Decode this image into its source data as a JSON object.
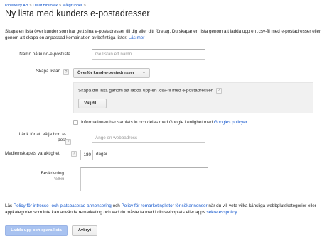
{
  "breadcrumb": {
    "items": [
      "Pineberry AB",
      "Delat bibliotek",
      "Målgrupper"
    ],
    "separator": ">"
  },
  "page": {
    "title": "Ny lista med kunders e-postadresser"
  },
  "intro": {
    "text": "Skapa en lista över kunder som har gett sina e-postadresser till dig eller ditt företag. Du skapar en lista genom att ladda upp en .csv-fil med e-postadresser eller genom att skapa en anpassad kombination av befintliga listor.",
    "link": "Läs mer"
  },
  "form": {
    "name": {
      "label": "Namn på kund-e-postlista",
      "placeholder": "Ge listan ett namn"
    },
    "create": {
      "label": "Skapa listan",
      "help": "?",
      "dropdown_value": "Överför kund-e-postadresser",
      "panel_text": "Skapa din lista genom att ladda upp en .csv-fil med e-postadresser",
      "panel_help": "?",
      "choose_file_button": "Välj fil ..."
    },
    "consent": {
      "text": "Informationen har samlats in och delas med Google i enlighet med",
      "link": "Googles policyer",
      "after": "."
    },
    "optout": {
      "label_line1": "Länk för att välja bort e-",
      "label_line2": "post",
      "help": "?",
      "placeholder": "Ange en webbadress"
    },
    "duration": {
      "label": "Medlemskapets varaktighet",
      "help": "?",
      "value": "180",
      "unit": "dagar"
    },
    "description": {
      "label": "Beskrivning",
      "sublabel": "Valfritt"
    }
  },
  "footer": {
    "text_1": "Läs",
    "link_1": "Policy för intresse- och platsbaserad annonsering",
    "text_2": "och",
    "link_2": "Policy för remarketinglistor för sökannonser",
    "text_3": "när du vill veta vilka känsliga webbplatskategorier eller appkategorier som inte kan använda remarketing och vad du måste ta med i din webbplats eller apps",
    "link_3": "sekretesspolicy",
    "text_4": "."
  },
  "actions": {
    "upload_save": "Ladda upp och spara lista",
    "cancel": "Avbryt"
  }
}
